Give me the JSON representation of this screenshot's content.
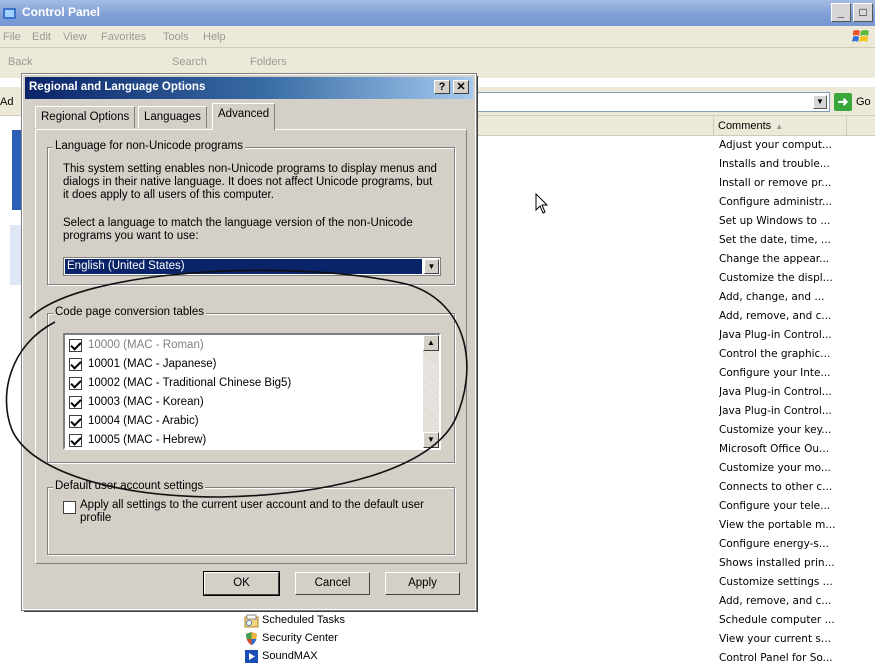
{
  "window": {
    "title": "Control Panel",
    "minimize_label": "_",
    "maximize_label": "□"
  },
  "menu": [
    "File",
    "Edit",
    "View",
    "Favorites",
    "Tools",
    "Help"
  ],
  "toolbar": {
    "back_label": "Back",
    "search_label": "Search",
    "folders_label": "Folders"
  },
  "address": {
    "label": "Ad",
    "go_label": "Go"
  },
  "list": {
    "comments_header": "Comments",
    "comments": [
      "Adjust your comput...",
      "Installs and trouble...",
      "Install or remove pr...",
      "Configure administr...",
      "Set up Windows to ...",
      "Set the date, time, ...",
      "Change the appear...",
      "Customize the displ...",
      "Add, change, and ...",
      "Add, remove, and c...",
      "Java Plug-in Control...",
      "Control the graphic...",
      "Configure your Inte...",
      "Java Plug-in Control...",
      "Java Plug-in Control...",
      "Customize your key...",
      "Microsoft Office Ou...",
      "Customize your mo...",
      "Connects to other c...",
      "Configure your tele...",
      "View the portable m...",
      "Configure energy-s...",
      "Shows installed prin...",
      "Customize settings ...",
      "Add, remove, and c...",
      "Schedule computer ...",
      "View your current s...",
      "Control Panel for So..."
    ],
    "items": [
      {
        "label": "Scheduled Tasks",
        "icon": "scheduled-tasks-icon"
      },
      {
        "label": "Security Center",
        "icon": "security-center-icon"
      },
      {
        "label": "SoundMAX",
        "icon": "soundmax-icon"
      }
    ]
  },
  "dialog": {
    "title": "Regional and Language Options",
    "help_label": "?",
    "close_label": "✕",
    "tabs": [
      "Regional Options",
      "Languages",
      "Advanced"
    ],
    "active_tab": "Advanced",
    "lang_group": {
      "label": "Language for non-Unicode programs",
      "description": "This system setting enables non-Unicode programs to display menus and dialogs in their native language. It does not affect Unicode programs, but it does apply to all users of this computer.",
      "prompt": "Select a language to match the language version of the non-Unicode programs you want to use:",
      "selected_language": "English (United States)"
    },
    "codepage_group": {
      "label": "Code page conversion tables",
      "items": [
        {
          "label": "10000 (MAC - Roman)",
          "checked": true,
          "disabled": true
        },
        {
          "label": "10001 (MAC - Japanese)",
          "checked": true,
          "disabled": false
        },
        {
          "label": "10002 (MAC - Traditional Chinese Big5)",
          "checked": true,
          "disabled": false
        },
        {
          "label": "10003 (MAC - Korean)",
          "checked": true,
          "disabled": false
        },
        {
          "label": "10004 (MAC - Arabic)",
          "checked": true,
          "disabled": false
        },
        {
          "label": "10005 (MAC - Hebrew)",
          "checked": true,
          "disabled": false
        }
      ]
    },
    "user_group": {
      "label": "Default user account settings",
      "apply_all_label": "Apply all settings to the current user account and to the default user profile",
      "apply_all_checked": false
    },
    "buttons": {
      "ok": "OK",
      "cancel": "Cancel",
      "apply": "Apply"
    }
  }
}
